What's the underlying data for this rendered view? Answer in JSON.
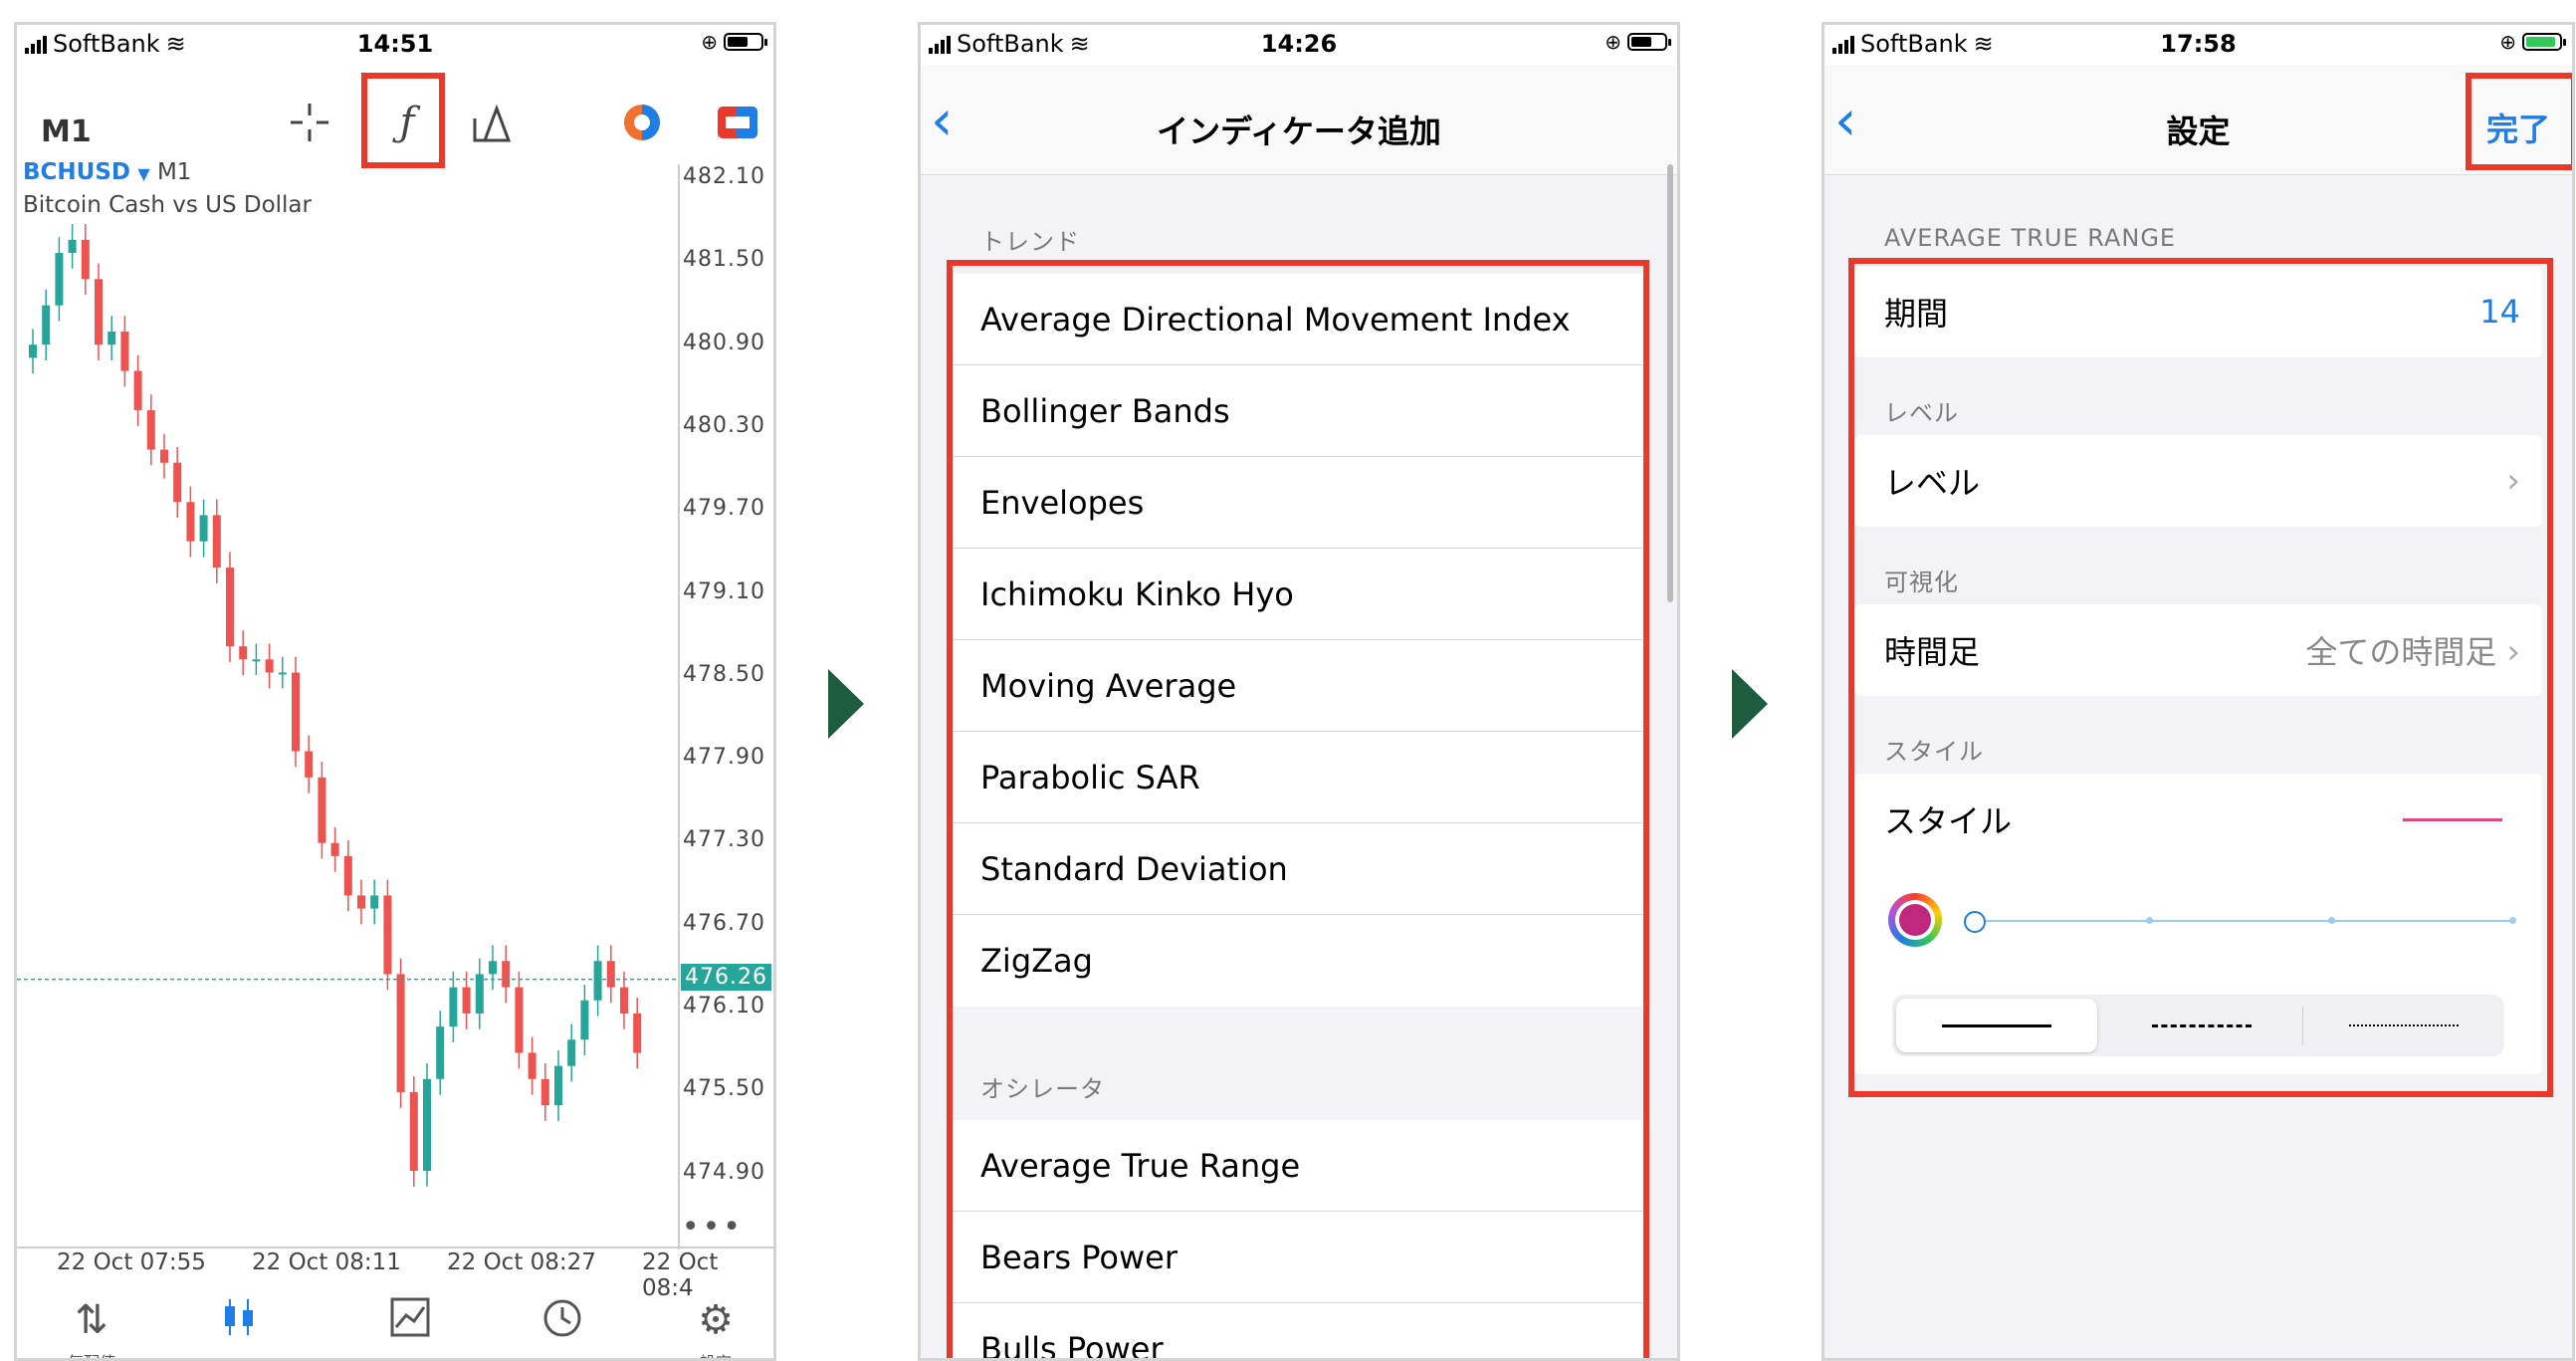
{
  "phone1": {
    "status": {
      "carrier": "SoftBank",
      "time": "14:51"
    },
    "timeframe": "M1",
    "symbol": "BCHUSD",
    "symbol_timeframe": "M1",
    "symbol_desc": "Bitcoin Cash vs US Dollar",
    "price_levels": [
      "482.10",
      "481.50",
      "480.90",
      "480.30",
      "479.70",
      "479.10",
      "478.50",
      "477.90",
      "477.30",
      "476.70",
      "476.10",
      "475.50",
      "474.90"
    ],
    "current_price": "476.26",
    "time_labels": [
      "22 Oct 07:55",
      "22 Oct 08:11",
      "22 Oct 08:27",
      "22 Oct 08:4"
    ],
    "nav_labels": [
      "気配値",
      "チャート",
      "トレード",
      "履歴",
      "設定"
    ],
    "colors": {
      "bull": "#26a69a",
      "bear": "#ef5350",
      "accent": "#1f7de6"
    }
  },
  "phone2": {
    "status": {
      "carrier": "SoftBank",
      "time": "14:26"
    },
    "title": "インディケータ追加",
    "sections": [
      {
        "header": "トレンド",
        "items": [
          "Average Directional Movement Index",
          "Bollinger Bands",
          "Envelopes",
          "Ichimoku Kinko Hyo",
          "Moving Average",
          "Parabolic SAR",
          "Standard Deviation",
          "ZigZag"
        ]
      },
      {
        "header": "オシレータ",
        "items": [
          "Average True Range",
          "Bears Power",
          "Bulls Power"
        ]
      }
    ]
  },
  "phone3": {
    "status": {
      "carrier": "SoftBank",
      "time": "17:58"
    },
    "title": "設定",
    "done": "完了",
    "indicator_header": "AVERAGE TRUE RANGE",
    "period_label": "期間",
    "period_value": "14",
    "level_header": "レベル",
    "level_label": "レベル",
    "visual_header": "可視化",
    "timeframe_label": "時間足",
    "timeframe_value": "全ての時間足",
    "style_header": "スタイル",
    "style_label": "スタイル",
    "line_color": "#e0457b"
  },
  "arrow_color": "#1d5c3f"
}
